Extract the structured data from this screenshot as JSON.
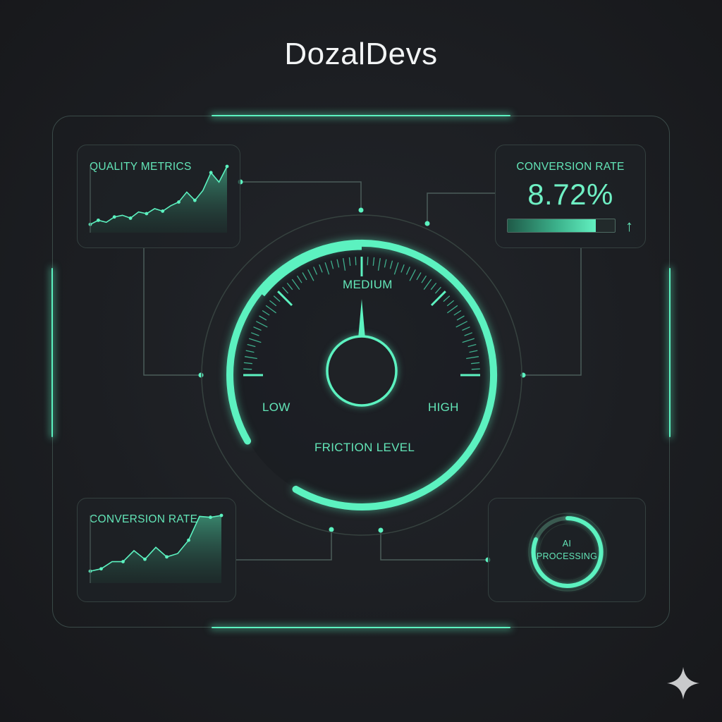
{
  "app": {
    "title": "DozalDevs"
  },
  "quality_metrics": {
    "title": "QUALITY METRICS",
    "chart_data": {
      "type": "area",
      "values": [
        2,
        3,
        2.5,
        3.8,
        4.2,
        3.5,
        5,
        4.6,
        5.8,
        5.2,
        6.5,
        7.4,
        9.8,
        7.8,
        10.2,
        14.5,
        12.2,
        16
      ]
    }
  },
  "conversion_metric": {
    "title": "CONVERSION RATE",
    "value": "8.72%",
    "progress": 0.82,
    "trend_icon": "arrow-up-icon",
    "trend_glyph": "↑"
  },
  "conversion_chart": {
    "title": "CONVERSION RATE",
    "chart_data": {
      "type": "area",
      "values": [
        2.5,
        3,
        4.5,
        4.5,
        6.8,
        5,
        7.5,
        5.5,
        6.2,
        9,
        14,
        13.8,
        14.2
      ]
    }
  },
  "gauge": {
    "low_label": "LOW",
    "medium_label": "MEDIUM",
    "high_label": "HIGH",
    "caption": "FRICTION LEVEL",
    "level": "MEDIUM",
    "needle_value": 0.5
  },
  "ai_badge": {
    "line1": "AI",
    "line2": "PROCESSING"
  },
  "colors": {
    "accent": "#5cf2c0",
    "accent_dim": "#3fae8c",
    "background": "#1c1e22",
    "line": "#4b5d5a"
  },
  "icons": {
    "corner": "sparkle-icon"
  }
}
